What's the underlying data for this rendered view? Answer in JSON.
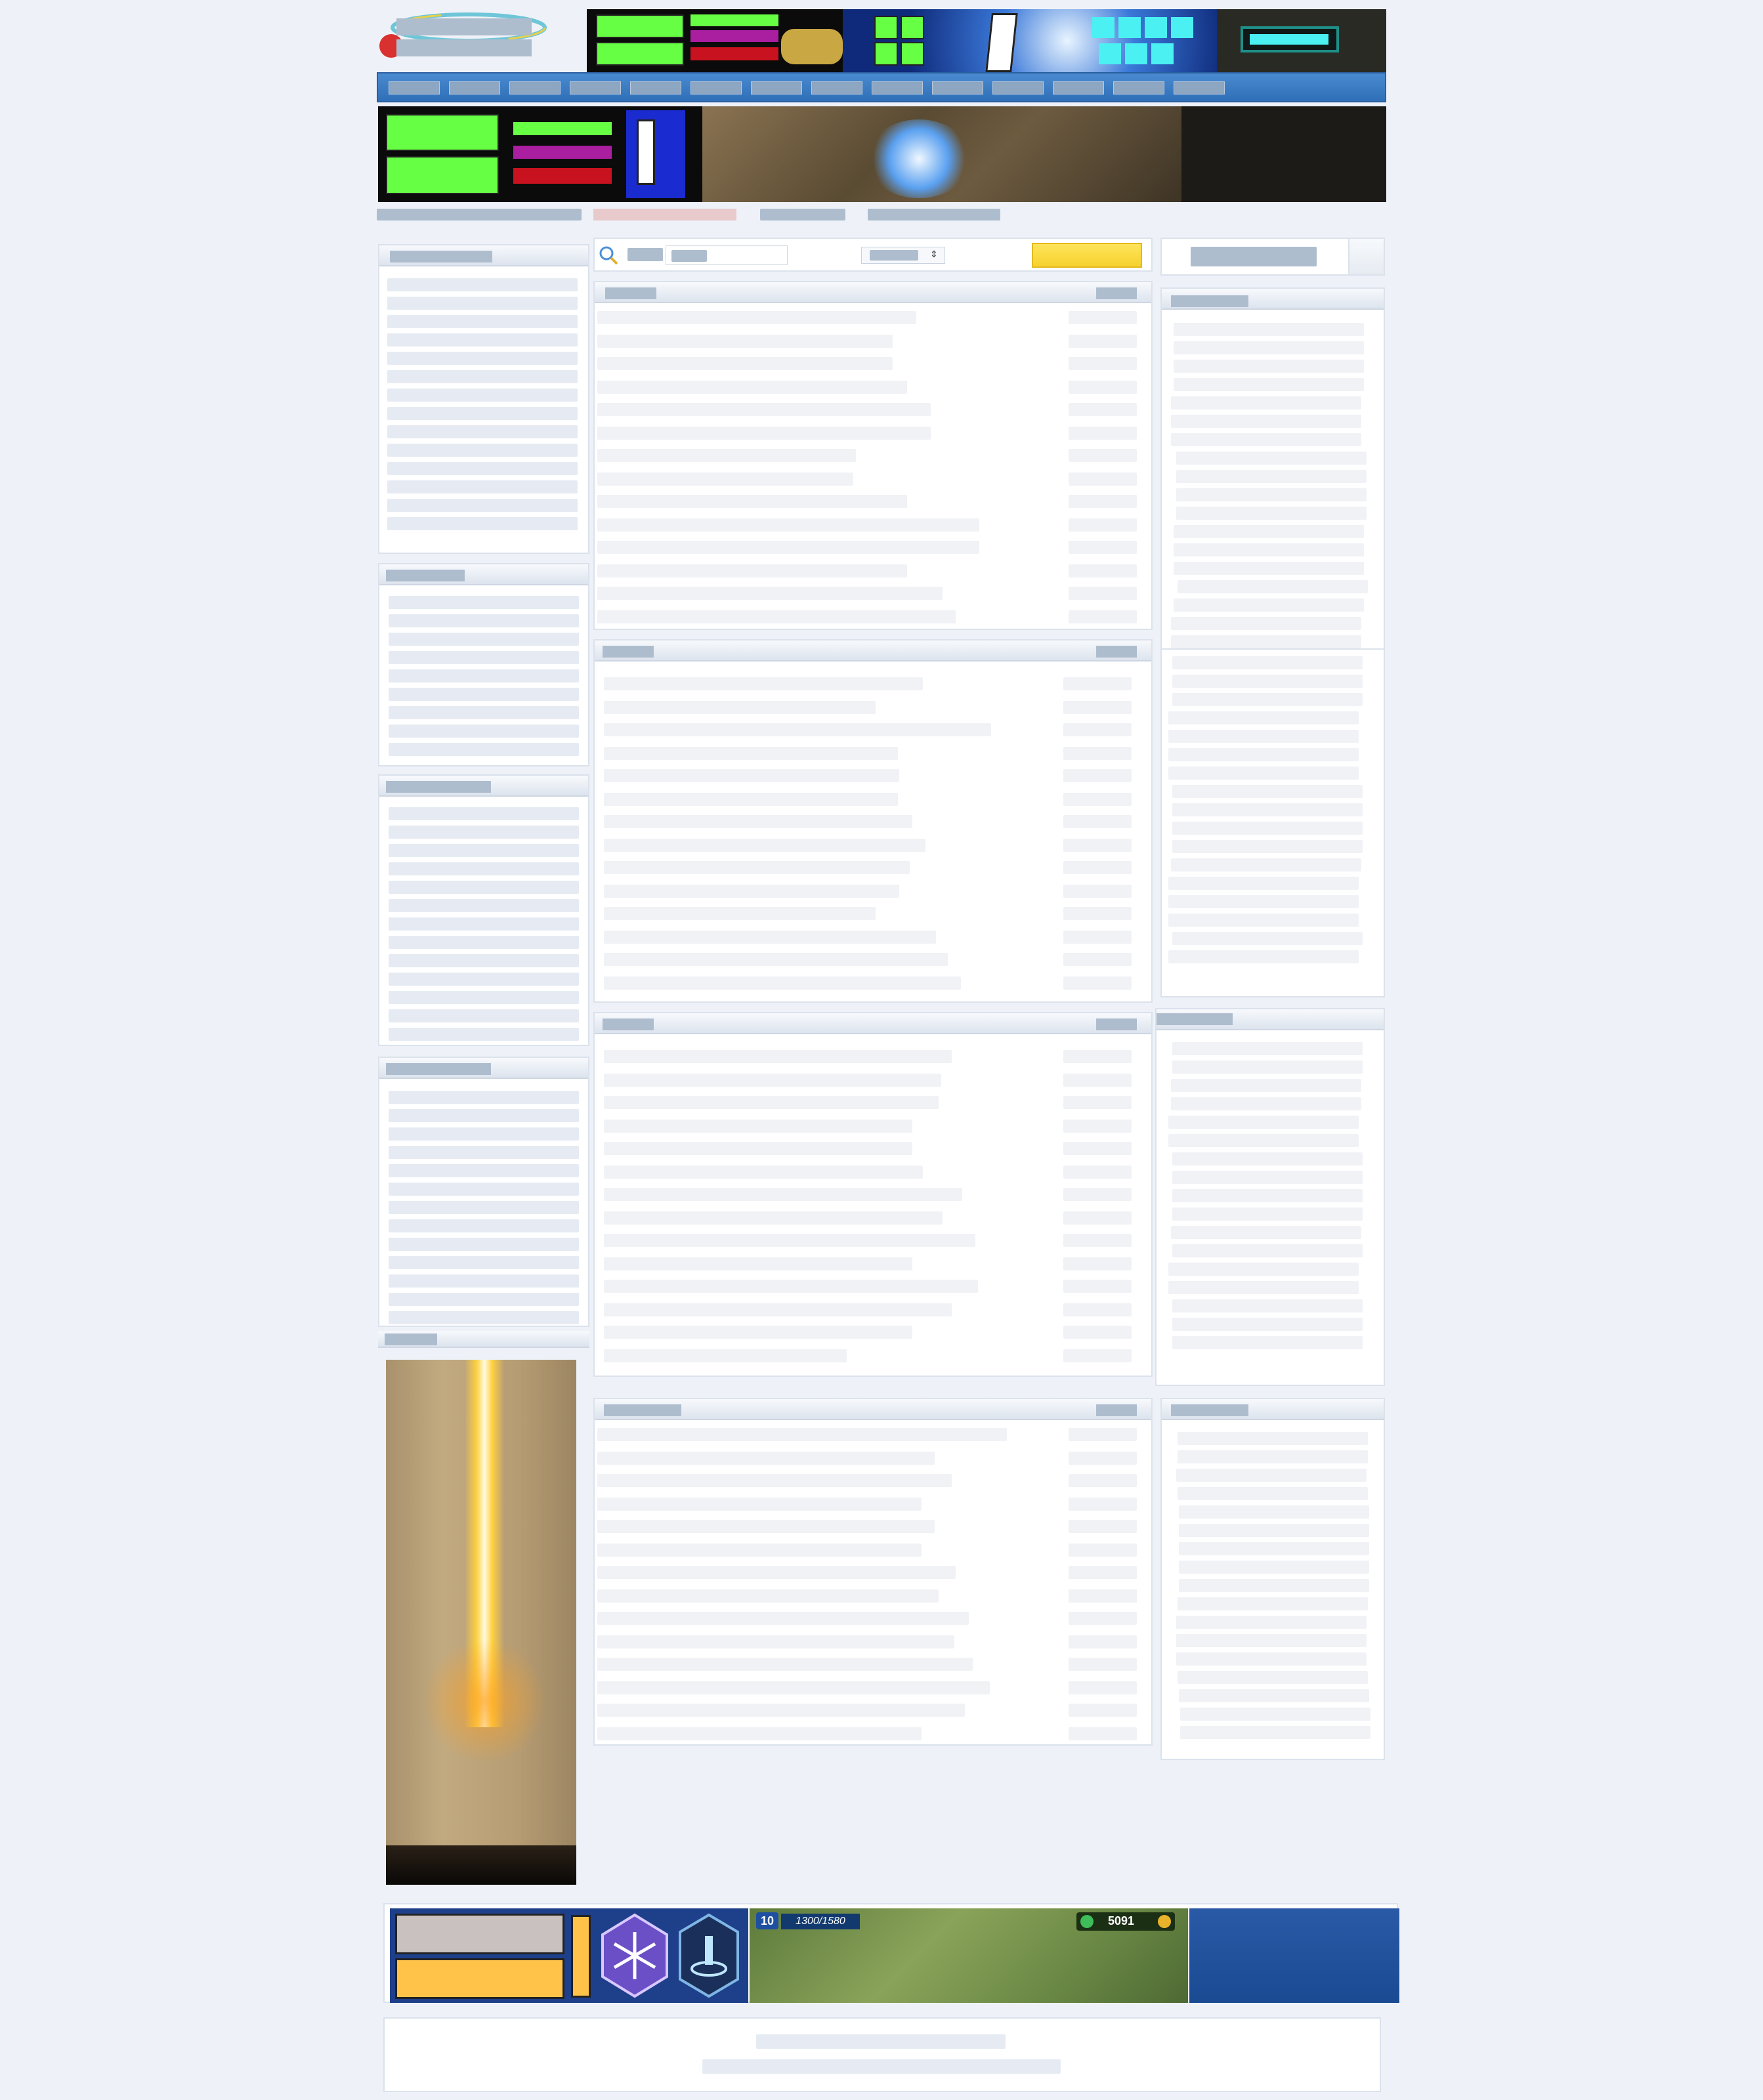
{
  "brand": {
    "logo_icon": "site-logo-icon"
  },
  "header": {
    "nav_items_count_shown": 14
  },
  "search": {
    "icon": "search-icon",
    "dropdown_icon": "chevron-updown-icon",
    "button_color": "#f6d22e"
  },
  "colors": {
    "nav_bar": "#2f6fb7",
    "banner_green": "#66ff44",
    "banner_purple": "#aa1ea0",
    "banner_red": "#c8121f",
    "banner_cyan": "#4af0f2",
    "page_bg": "#eef2f8"
  },
  "footer_banner": {
    "level": "10",
    "progress_text": "1300/1580",
    "coins": "5091"
  }
}
